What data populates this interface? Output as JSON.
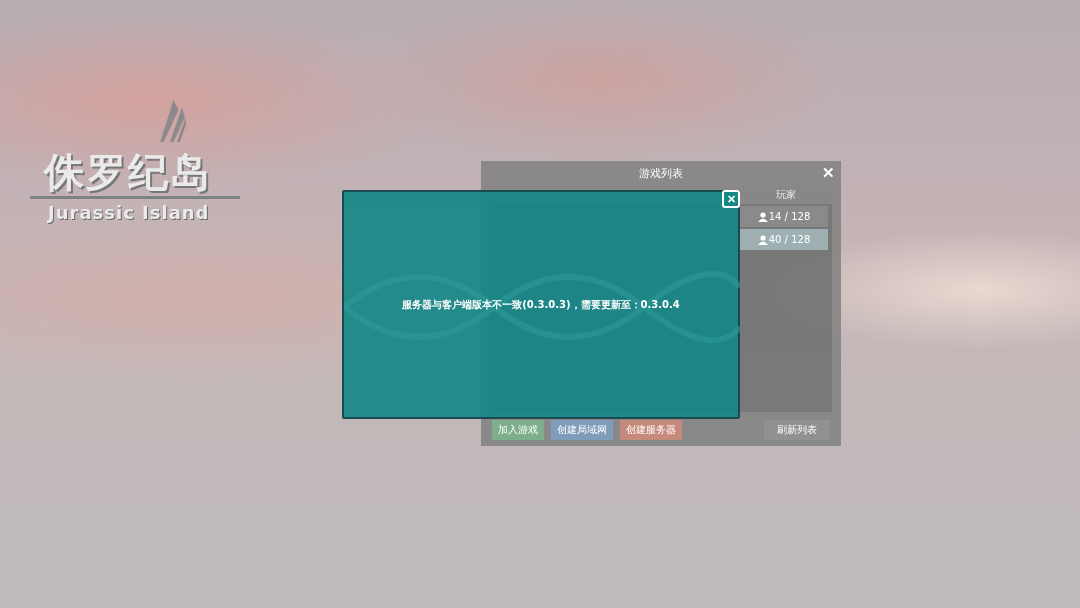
{
  "logo": {
    "title": "侏罗纪岛",
    "subtitle": "Jurassic Island"
  },
  "server_list": {
    "title": "游戏列表",
    "close": "✕",
    "columns": [
      {
        "label": "玩家"
      }
    ],
    "rows": [
      {
        "players": "14 / 128",
        "selected": false
      },
      {
        "players": "40 / 128",
        "selected": true
      }
    ],
    "buttons": [
      {
        "label": "加入游戏",
        "kind": "join"
      },
      {
        "label": "创建局域网",
        "kind": "lan"
      },
      {
        "label": "创建服务器",
        "kind": "server"
      },
      {
        "label": "刷新列表",
        "kind": "refresh"
      }
    ]
  },
  "dialog": {
    "message": "服务器与客户端版本不一致(0.3.0.3)，需要更新至：0.3.0.4",
    "close": "✕"
  }
}
